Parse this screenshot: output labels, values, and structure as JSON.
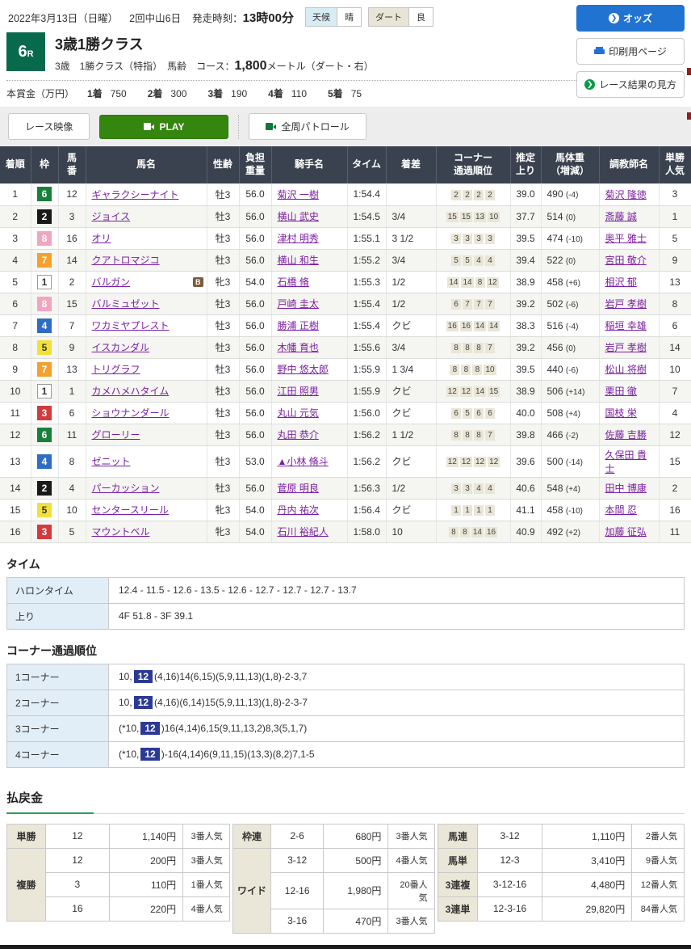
{
  "header": {
    "date": "2022年3月13日（日曜）",
    "meeting": "2回中山6日",
    "start_label": "発走時刻：",
    "start_time": "13時00分",
    "weather_label": "天候",
    "weather_value": "晴",
    "track_label": "ダート",
    "track_condition": "良",
    "buttons": {
      "odds": "オッズ",
      "print": "印刷用ページ",
      "guide": "レース結果の見方"
    }
  },
  "race": {
    "number_main": "6",
    "number_sub": "R",
    "title": "3歳1勝クラス",
    "conditions": "3歳　1勝クラス（特指）　馬齢",
    "course_label": "コース：",
    "course_distance": "1,800",
    "course_tail": "メートル（ダート・右）",
    "prize_label": "本賞金（万円）",
    "prizes": [
      {
        "place": "1着",
        "amount": "750"
      },
      {
        "place": "2着",
        "amount": "300"
      },
      {
        "place": "3着",
        "amount": "190"
      },
      {
        "place": "4着",
        "amount": "110"
      },
      {
        "place": "5着",
        "amount": "75"
      }
    ]
  },
  "video": {
    "race_video": "レース映像",
    "play": "PLAY",
    "patrol": "全周パトロール"
  },
  "results": {
    "headers": [
      "着順",
      "枠",
      "馬\n番",
      "馬名",
      "性齢",
      "負担\n重量",
      "騎手名",
      "タイム",
      "着差",
      "コーナー\n通過順位",
      "推定\n上り",
      "馬体重\n（増減）",
      "調教師名",
      "単勝\n人気"
    ],
    "rows": [
      {
        "finish": "1",
        "frame": "6",
        "number": "12",
        "horse": "ギャラクシーナイト",
        "blinker": false,
        "sexage": "牡3",
        "weight": "56.0",
        "jockey": "菊沢 一樹",
        "time": "1:54.4",
        "margin": "",
        "corners": [
          "2",
          "2",
          "2",
          "2"
        ],
        "last3f": "39.0",
        "body": "490",
        "diff": "(-4)",
        "trainer": "菊沢 隆徳",
        "fav": "3"
      },
      {
        "finish": "2",
        "frame": "2",
        "number": "3",
        "horse": "ジョイス",
        "blinker": false,
        "sexage": "牡3",
        "weight": "56.0",
        "jockey": "横山 武史",
        "time": "1:54.5",
        "margin": "3/4",
        "corners": [
          "15",
          "15",
          "13",
          "10"
        ],
        "last3f": "37.7",
        "body": "514",
        "diff": "(0)",
        "trainer": "斎藤 誠",
        "fav": "1"
      },
      {
        "finish": "3",
        "frame": "8",
        "number": "16",
        "horse": "オリ",
        "blinker": false,
        "sexage": "牡3",
        "weight": "56.0",
        "jockey": "津村 明秀",
        "time": "1:55.1",
        "margin": "3 1/2",
        "corners": [
          "3",
          "3",
          "3",
          "3"
        ],
        "last3f": "39.5",
        "body": "474",
        "diff": "(-10)",
        "trainer": "奥平 雅士",
        "fav": "5"
      },
      {
        "finish": "4",
        "frame": "7",
        "number": "14",
        "horse": "クアトロマジコ",
        "blinker": false,
        "sexage": "牡3",
        "weight": "56.0",
        "jockey": "横山 和生",
        "time": "1:55.2",
        "margin": "3/4",
        "corners": [
          "5",
          "5",
          "4",
          "4"
        ],
        "last3f": "39.4",
        "body": "522",
        "diff": "(0)",
        "trainer": "宮田 敬介",
        "fav": "9"
      },
      {
        "finish": "5",
        "frame": "1",
        "number": "2",
        "horse": "バルガン",
        "blinker": true,
        "sexage": "牝3",
        "weight": "54.0",
        "jockey": "石橋 脩",
        "time": "1:55.3",
        "margin": "1/2",
        "corners": [
          "14",
          "14",
          "8",
          "12"
        ],
        "last3f": "38.9",
        "body": "458",
        "diff": "(+6)",
        "trainer": "相沢 郁",
        "fav": "13"
      },
      {
        "finish": "6",
        "frame": "8",
        "number": "15",
        "horse": "バルミュゼット",
        "blinker": false,
        "sexage": "牡3",
        "weight": "56.0",
        "jockey": "戸崎 圭太",
        "time": "1:55.4",
        "margin": "1/2",
        "corners": [
          "6",
          "7",
          "7",
          "7"
        ],
        "last3f": "39.2",
        "body": "502",
        "diff": "(-6)",
        "trainer": "岩戸 孝樹",
        "fav": "8"
      },
      {
        "finish": "7",
        "frame": "4",
        "number": "7",
        "horse": "ワカミヤプレスト",
        "blinker": false,
        "sexage": "牡3",
        "weight": "56.0",
        "jockey": "勝浦 正樹",
        "time": "1:55.4",
        "margin": "クビ",
        "corners": [
          "16",
          "16",
          "14",
          "14"
        ],
        "last3f": "38.3",
        "body": "516",
        "diff": "(-4)",
        "trainer": "稲垣 幸雄",
        "fav": "6"
      },
      {
        "finish": "8",
        "frame": "5",
        "number": "9",
        "horse": "イスカンダル",
        "blinker": false,
        "sexage": "牡3",
        "weight": "56.0",
        "jockey": "木幡 育也",
        "time": "1:55.6",
        "margin": "3/4",
        "corners": [
          "8",
          "8",
          "8",
          "7"
        ],
        "last3f": "39.2",
        "body": "456",
        "diff": "(0)",
        "trainer": "岩戸 孝樹",
        "fav": "14"
      },
      {
        "finish": "9",
        "frame": "7",
        "number": "13",
        "horse": "トリグラフ",
        "blinker": false,
        "sexage": "牡3",
        "weight": "56.0",
        "jockey": "野中 悠太郎",
        "time": "1:55.9",
        "margin": "1 3/4",
        "corners": [
          "8",
          "8",
          "8",
          "10"
        ],
        "last3f": "39.5",
        "body": "440",
        "diff": "(-6)",
        "trainer": "松山 将樹",
        "fav": "10"
      },
      {
        "finish": "10",
        "frame": "1",
        "number": "1",
        "horse": "カメハメハタイム",
        "blinker": false,
        "sexage": "牡3",
        "weight": "56.0",
        "jockey": "江田 照男",
        "time": "1:55.9",
        "margin": "クビ",
        "corners": [
          "12",
          "12",
          "14",
          "15"
        ],
        "last3f": "38.9",
        "body": "506",
        "diff": "(+14)",
        "trainer": "栗田 徹",
        "fav": "7"
      },
      {
        "finish": "11",
        "frame": "3",
        "number": "6",
        "horse": "ショウナンダール",
        "blinker": false,
        "sexage": "牡3",
        "weight": "56.0",
        "jockey": "丸山 元気",
        "time": "1:56.0",
        "margin": "クビ",
        "corners": [
          "6",
          "5",
          "6",
          "6"
        ],
        "last3f": "40.0",
        "body": "508",
        "diff": "(+4)",
        "trainer": "国枝 栄",
        "fav": "4"
      },
      {
        "finish": "12",
        "frame": "6",
        "number": "11",
        "horse": "グローリー",
        "blinker": false,
        "sexage": "牡3",
        "weight": "56.0",
        "jockey": "丸田 恭介",
        "time": "1:56.2",
        "margin": "1 1/2",
        "corners": [
          "8",
          "8",
          "8",
          "7"
        ],
        "last3f": "39.8",
        "body": "466",
        "diff": "(-2)",
        "trainer": "佐藤 吉勝",
        "fav": "12"
      },
      {
        "finish": "13",
        "frame": "4",
        "number": "8",
        "horse": "ゼニット",
        "blinker": false,
        "sexage": "牡3",
        "weight": "53.0",
        "jockey": "▲小林 脩斗",
        "time": "1:56.2",
        "margin": "クビ",
        "corners": [
          "12",
          "12",
          "12",
          "12"
        ],
        "last3f": "39.6",
        "body": "500",
        "diff": "(-14)",
        "trainer": "久保田 貴士",
        "fav": "15"
      },
      {
        "finish": "14",
        "frame": "2",
        "number": "4",
        "horse": "パーカッション",
        "blinker": false,
        "sexage": "牡3",
        "weight": "56.0",
        "jockey": "菅原 明良",
        "time": "1:56.3",
        "margin": "1/2",
        "corners": [
          "3",
          "3",
          "4",
          "4"
        ],
        "last3f": "40.6",
        "body": "548",
        "diff": "(+4)",
        "trainer": "田中 博康",
        "fav": "2"
      },
      {
        "finish": "15",
        "frame": "5",
        "number": "10",
        "horse": "センタースリール",
        "blinker": false,
        "sexage": "牝3",
        "weight": "54.0",
        "jockey": "丹内 祐次",
        "time": "1:56.4",
        "margin": "クビ",
        "corners": [
          "1",
          "1",
          "1",
          "1"
        ],
        "last3f": "41.1",
        "body": "458",
        "diff": "(-10)",
        "trainer": "本間 忍",
        "fav": "16"
      },
      {
        "finish": "16",
        "frame": "3",
        "number": "5",
        "horse": "マウントベル",
        "blinker": false,
        "sexage": "牝3",
        "weight": "54.0",
        "jockey": "石川 裕紀人",
        "time": "1:58.0",
        "margin": "10",
        "corners": [
          "8",
          "8",
          "14",
          "16"
        ],
        "last3f": "40.9",
        "body": "492",
        "diff": "(+2)",
        "trainer": "加藤 征弘",
        "fav": "11"
      }
    ]
  },
  "time_section": {
    "title": "タイム",
    "rows": [
      {
        "label": "ハロンタイム",
        "value": "12.4 - 11.5 - 12.6 - 13.5 - 12.6 - 12.7 - 12.7 - 12.7 - 13.7"
      },
      {
        "label": "上り",
        "value": "4F 51.8 - 3F 39.1"
      }
    ]
  },
  "corner_section": {
    "title": "コーナー通過順位",
    "rows": [
      {
        "label": "1コーナー",
        "before": "10,",
        "highlight": "12",
        "after": "(4,16)14(6,15)(5,9,11,13)(1,8)-2-3,7"
      },
      {
        "label": "2コーナー",
        "before": "10,",
        "highlight": "12",
        "after": "(4,16)(6,14)15(5,9,11,13)(1,8)-2-3-7"
      },
      {
        "label": "3コーナー",
        "before": "(*10,",
        "highlight": "12",
        "after": ")16(4,14)6,15(9,11,13,2)8,3(5,1,7)"
      },
      {
        "label": "4コーナー",
        "before": "(*10,",
        "highlight": "12",
        "after": ")-16(4,14)6(9,11,15)(13,3)(8,2)7,1-5"
      }
    ]
  },
  "payout": {
    "title": "払戻金",
    "groups": [
      {
        "rows": [
          {
            "type": "単勝",
            "combo": "12",
            "amount": "1,140円",
            "fav": "3番人気"
          },
          {
            "type": "複勝",
            "combo": "12",
            "amount": "200円",
            "fav": "3番人気"
          },
          {
            "type": null,
            "combo": "3",
            "amount": "110円",
            "fav": "1番人気"
          },
          {
            "type": null,
            "combo": "16",
            "amount": "220円",
            "fav": "4番人気"
          }
        ]
      },
      {
        "rows": [
          {
            "type": "枠連",
            "combo": "2-6",
            "amount": "680円",
            "fav": "3番人気"
          },
          {
            "type": "ワイド",
            "combo": "3-12",
            "amount": "500円",
            "fav": "4番人気"
          },
          {
            "type": null,
            "combo": "12-16",
            "amount": "1,980円",
            "fav": "20番人気"
          },
          {
            "type": null,
            "combo": "3-16",
            "amount": "470円",
            "fav": "3番人気"
          }
        ]
      },
      {
        "rows": [
          {
            "type": "馬連",
            "combo": "3-12",
            "amount": "1,110円",
            "fav": "2番人気"
          },
          {
            "type": "馬単",
            "combo": "12-3",
            "amount": "3,410円",
            "fav": "9番人気"
          },
          {
            "type": "3連複",
            "combo": "3-12-16",
            "amount": "4,480円",
            "fav": "12番人気"
          },
          {
            "type": "3連単",
            "combo": "12-3-16",
            "amount": "29,820円",
            "fav": "84番人気"
          }
        ]
      }
    ]
  }
}
